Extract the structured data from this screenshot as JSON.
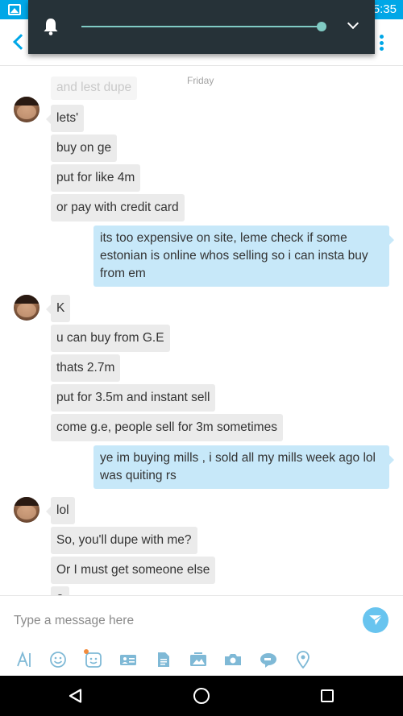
{
  "status_bar": {
    "time": "5:35",
    "notification_icon": "image-icon"
  },
  "volume_popup": {
    "icon": "bell-icon",
    "level": 1.0,
    "expand_icon": "chevron-down-icon"
  },
  "header": {
    "back_icon": "chevron-left-icon",
    "menu_icon": "more-vertical-icon"
  },
  "chat": {
    "date_label": "Friday",
    "messages": [
      {
        "from": "them",
        "text": "and lest dupe"
      },
      {
        "from": "them",
        "text": "lets'"
      },
      {
        "from": "them",
        "text": "buy on ge"
      },
      {
        "from": "them",
        "text": "put for like 4m"
      },
      {
        "from": "them",
        "text": "or pay with credit card"
      },
      {
        "from": "me",
        "text": "its too expensive on site, leme check if some estonian is online whos selling so i can insta buy from em"
      },
      {
        "from": "them",
        "text": "K"
      },
      {
        "from": "them",
        "text": "u can buy from G.E"
      },
      {
        "from": "them",
        "text": "thats 2.7m"
      },
      {
        "from": "them",
        "text": "put for 3.5m and instant sell"
      },
      {
        "from": "them",
        "text": "come g.e, people sell for 3m sometimes"
      },
      {
        "from": "me",
        "text": "ye im buying mills , i sold all my mills week ago lol was quiting rs"
      },
      {
        "from": "them",
        "text": "lol"
      },
      {
        "from": "them",
        "text": "So, you'll dupe with me?"
      },
      {
        "from": "them",
        "text": "Or I must get someone else"
      },
      {
        "from": "them",
        "text": "?"
      }
    ]
  },
  "composer": {
    "placeholder": "Type a message here",
    "send_icon": "send-icon",
    "tools": [
      "text-format-icon",
      "emoji-icon",
      "sticker-icon",
      "contact-card-icon",
      "file-icon",
      "media-icon",
      "camera-icon",
      "video-message-icon",
      "location-icon"
    ]
  },
  "colors": {
    "accent": "#00a7e7",
    "outgoing_bubble": "#c7e8f9",
    "incoming_bubble": "#ebebeb",
    "popup_bg": "#263238",
    "slider": "#80cbc4"
  },
  "nav_bar": {
    "icons": [
      "back-triangle-icon",
      "home-circle-icon",
      "recents-square-icon"
    ]
  }
}
